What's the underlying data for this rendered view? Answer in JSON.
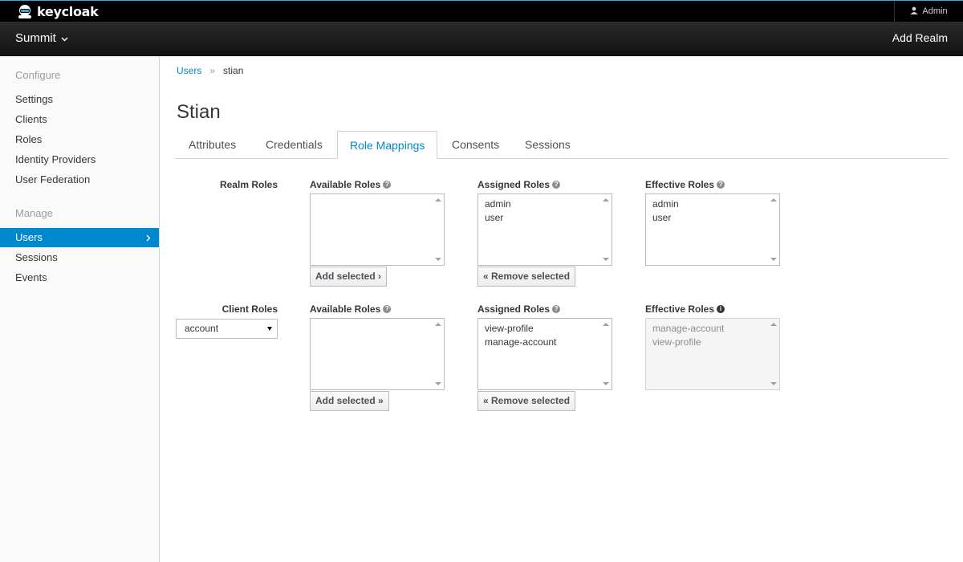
{
  "header": {
    "brand": "keycloak",
    "user": "Admin"
  },
  "realmbar": {
    "realm": "Summit",
    "add_realm": "Add Realm"
  },
  "sidebar": {
    "configure_label": "Configure",
    "configure_items": [
      "Settings",
      "Clients",
      "Roles",
      "Identity Providers",
      "User Federation"
    ],
    "manage_label": "Manage",
    "manage_items": [
      "Users",
      "Sessions",
      "Events"
    ],
    "active": "Users"
  },
  "breadcrumb": {
    "link": "Users",
    "separator": "»",
    "current": "stian"
  },
  "page": {
    "title": "Stian"
  },
  "tabs": [
    "Attributes",
    "Credentials",
    "Role Mappings",
    "Consents",
    "Sessions"
  ],
  "active_tab": "Role Mappings",
  "realm_roles": {
    "label": "Realm Roles",
    "available_label": "Available Roles",
    "available": [],
    "assigned_label": "Assigned Roles",
    "assigned": [
      "admin",
      "user"
    ],
    "effective_label": "Effective Roles",
    "effective": [
      "admin",
      "user"
    ],
    "add_button": "Add selected ›",
    "remove_button": "« Remove selected"
  },
  "client_roles": {
    "label": "Client Roles",
    "client": "account",
    "available_label": "Available Roles",
    "available": [],
    "assigned_label": "Assigned Roles",
    "assigned": [
      "view-profile",
      "manage-account"
    ],
    "effective_label": "Effective Roles",
    "effective": [
      "manage-account",
      "view-profile"
    ],
    "add_button": "Add selected »",
    "remove_button": "« Remove selected"
  }
}
